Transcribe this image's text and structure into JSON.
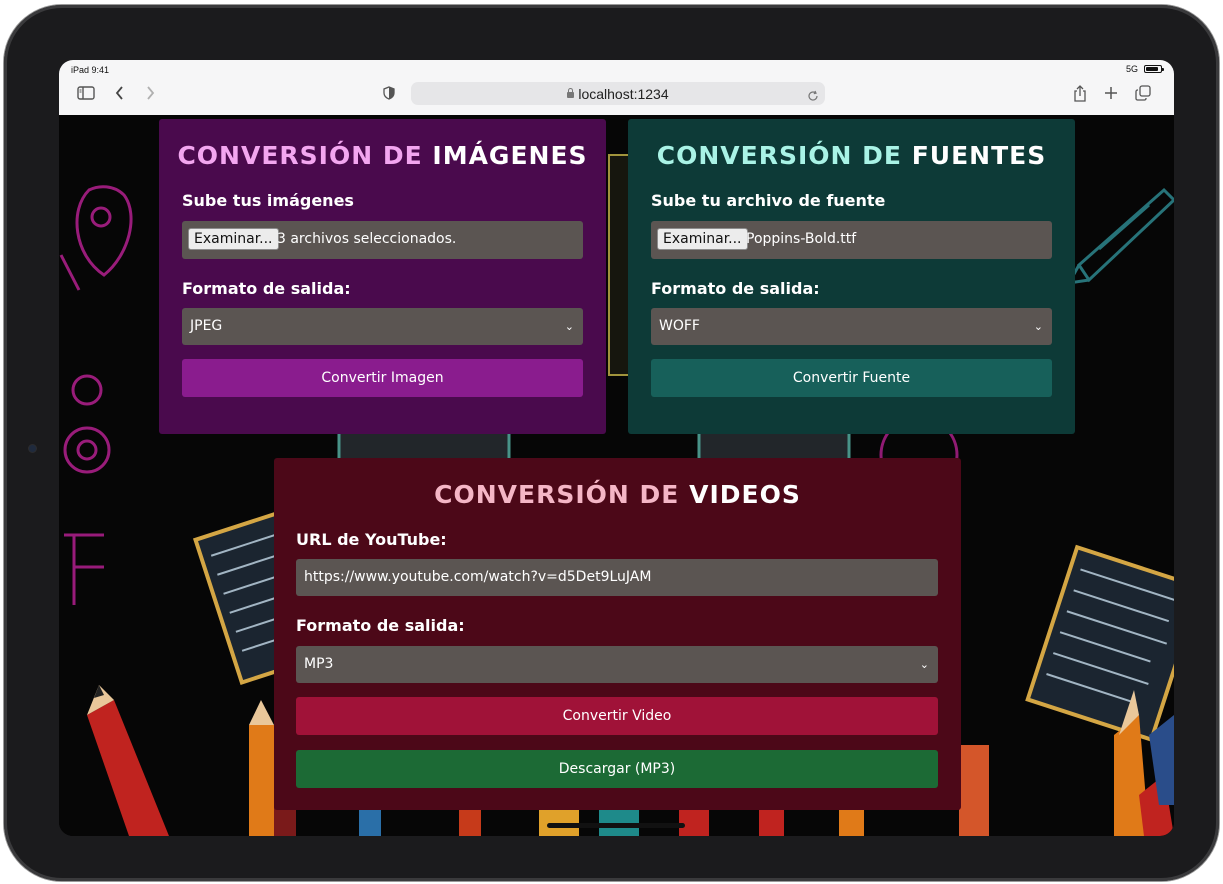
{
  "status": {
    "time": "iPad 9:41",
    "network": "5G"
  },
  "browser": {
    "address": "localhost:1234"
  },
  "images_card": {
    "title_a": "CONVERSIÓN DE",
    "title_b": "IMÁGENES",
    "upload_label": "Sube tus imágenes",
    "browse_label": "Examinar...",
    "file_status": "3 archivos seleccionados.",
    "format_label": "Formato de salida:",
    "format_value": "JPEG",
    "button_label": "Convertir Imagen",
    "colors": {
      "bg": "#4a0a4d",
      "title_a": "#f3a6f0",
      "button": "#8a1c8e"
    }
  },
  "fonts_card": {
    "title_a": "CONVERSIÓN DE",
    "title_b": "FUENTES",
    "upload_label": "Sube tu archivo de fuente",
    "browse_label": "Examinar...",
    "file_status": "Poppins-Bold.ttf",
    "format_label": "Formato de salida:",
    "format_value": "WOFF",
    "button_label": "Convertir Fuente",
    "colors": {
      "bg": "#0d3a37",
      "title_a": "#a9f3e6",
      "button": "#17605a"
    }
  },
  "videos_card": {
    "title_a": "CONVERSIÓN DE",
    "title_b": "VIDEOS",
    "url_label": "URL de YouTube:",
    "url_value": "https://www.youtube.com/watch?v=d5Det9LuJAM",
    "format_label": "Formato de salida:",
    "format_value": "MP3",
    "convert_label": "Convertir Video",
    "download_label": "Descargar (MP3)",
    "colors": {
      "bg": "#4c0818",
      "title_a": "#f5b6c6",
      "convert": "#a01238",
      "download": "#1c6a35"
    }
  }
}
